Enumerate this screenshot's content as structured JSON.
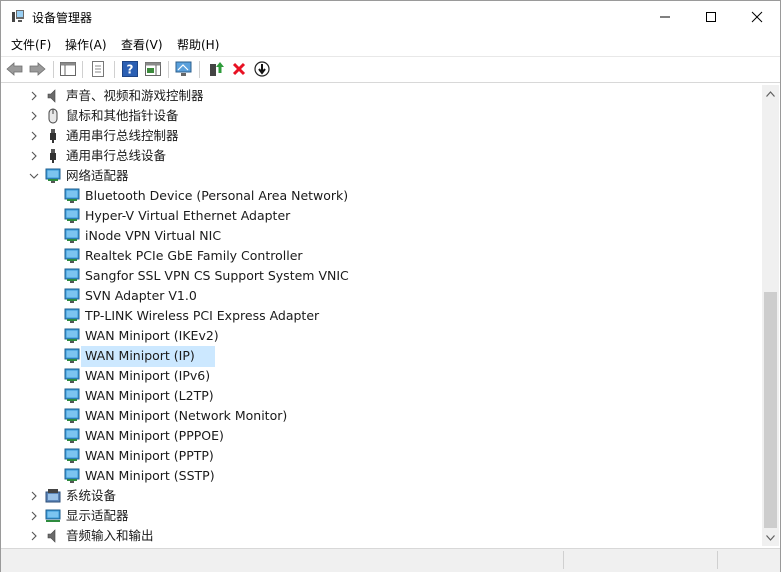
{
  "window": {
    "title": "设备管理器",
    "icon": "device-manager-icon"
  },
  "menu": [
    {
      "label": "文件(F)"
    },
    {
      "label": "操作(A)"
    },
    {
      "label": "查看(V)"
    },
    {
      "label": "帮助(H)"
    }
  ],
  "toolbar": {
    "buttons": [
      "back-icon",
      "forward-icon",
      "show-hide-tree-icon",
      "properties-icon",
      "help-icon",
      "action-pane-icon",
      "scan-hardware-icon",
      "update-driver-icon",
      "uninstall-icon",
      "disable-device-icon"
    ]
  },
  "tree": [
    {
      "label": "声音、视频和游戏控制器",
      "icon": "speaker-icon",
      "expanded": false,
      "level": 0
    },
    {
      "label": "鼠标和其他指针设备",
      "icon": "mouse-icon",
      "expanded": false,
      "level": 0
    },
    {
      "label": "通用串行总线控制器",
      "icon": "usb-icon",
      "expanded": false,
      "level": 0
    },
    {
      "label": "通用串行总线设备",
      "icon": "usb-icon",
      "expanded": false,
      "level": 0
    },
    {
      "label": "网络适配器",
      "icon": "network-adapter-icon",
      "expanded": true,
      "level": 0
    },
    {
      "label": "Bluetooth Device (Personal Area Network)",
      "icon": "network-adapter-icon",
      "level": 1
    },
    {
      "label": "Hyper-V Virtual Ethernet Adapter",
      "icon": "network-adapter-icon",
      "level": 1
    },
    {
      "label": "iNode VPN Virtual NIC",
      "icon": "network-adapter-icon",
      "level": 1
    },
    {
      "label": "Realtek PCIe GbE Family Controller",
      "icon": "network-adapter-icon",
      "level": 1
    },
    {
      "label": "Sangfor SSL VPN CS Support System VNIC",
      "icon": "network-adapter-icon",
      "level": 1
    },
    {
      "label": "SVN Adapter V1.0",
      "icon": "network-adapter-icon",
      "level": 1
    },
    {
      "label": "TP-LINK Wireless PCI Express Adapter",
      "icon": "network-adapter-icon",
      "level": 1
    },
    {
      "label": "WAN Miniport (IKEv2)",
      "icon": "network-adapter-icon",
      "level": 1
    },
    {
      "label": "WAN Miniport (IP)",
      "icon": "network-adapter-icon",
      "level": 1,
      "selected": true
    },
    {
      "label": "WAN Miniport (IPv6)",
      "icon": "network-adapter-icon",
      "level": 1
    },
    {
      "label": "WAN Miniport (L2TP)",
      "icon": "network-adapter-icon",
      "level": 1
    },
    {
      "label": "WAN Miniport (Network Monitor)",
      "icon": "network-adapter-icon",
      "level": 1
    },
    {
      "label": "WAN Miniport (PPPOE)",
      "icon": "network-adapter-icon",
      "level": 1
    },
    {
      "label": "WAN Miniport (PPTP)",
      "icon": "network-adapter-icon",
      "level": 1
    },
    {
      "label": "WAN Miniport (SSTP)",
      "icon": "network-adapter-icon",
      "level": 1
    },
    {
      "label": "系统设备",
      "icon": "system-device-icon",
      "expanded": false,
      "level": 0
    },
    {
      "label": "显示适配器",
      "icon": "display-adapter-icon",
      "expanded": false,
      "level": 0
    },
    {
      "label": "音频输入和输出",
      "icon": "speaker-icon",
      "expanded": false,
      "level": 0
    }
  ],
  "colors": {
    "selection": "#cce8ff",
    "uninstall_red": "#e81123",
    "update_green": "#2e9b3a"
  }
}
